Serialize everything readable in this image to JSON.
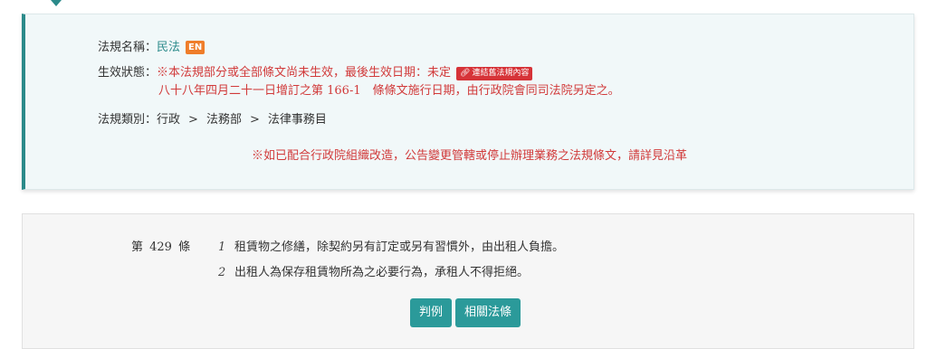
{
  "law_info": {
    "name_label": "法規名稱：",
    "name": "民法",
    "en_badge": "EN",
    "status_label": "生效狀態：",
    "status_text": "※本法規部分或全部條文尚未生效，最後生效日期：未定",
    "old_content_badge": "連結舊法規內容",
    "status_detail": "八十八年四月二十一日增訂之第 166-1　條條文施行日期，由行政院會同司法院另定之。",
    "category_label": "法規類別：",
    "category_path": [
      "行政",
      "法務部",
      "法律事務目"
    ],
    "category_separator": ">",
    "notice": "※如已配合行政院組織改造，公告變更管轄或停止辦理業務之法規條文，請詳見沿革"
  },
  "article": {
    "number": "第 429 條",
    "paragraphs": [
      {
        "num": "1",
        "text": "租賃物之修繕，除契約另有訂定或另有習慣外，由出租人負擔。"
      },
      {
        "num": "2",
        "text": "出租人為保存租賃物所為之必要行為，承租人不得拒絕。"
      }
    ],
    "buttons": {
      "judgments": "判例",
      "related_laws": "相關法條"
    }
  },
  "colors": {
    "accent": "#2b8a8a",
    "warning_red": "#d13a3a",
    "en_badge": "#ef7d2a",
    "button": "#2b9a9a"
  },
  "icons": {
    "old_content_badge": "link-icon"
  }
}
